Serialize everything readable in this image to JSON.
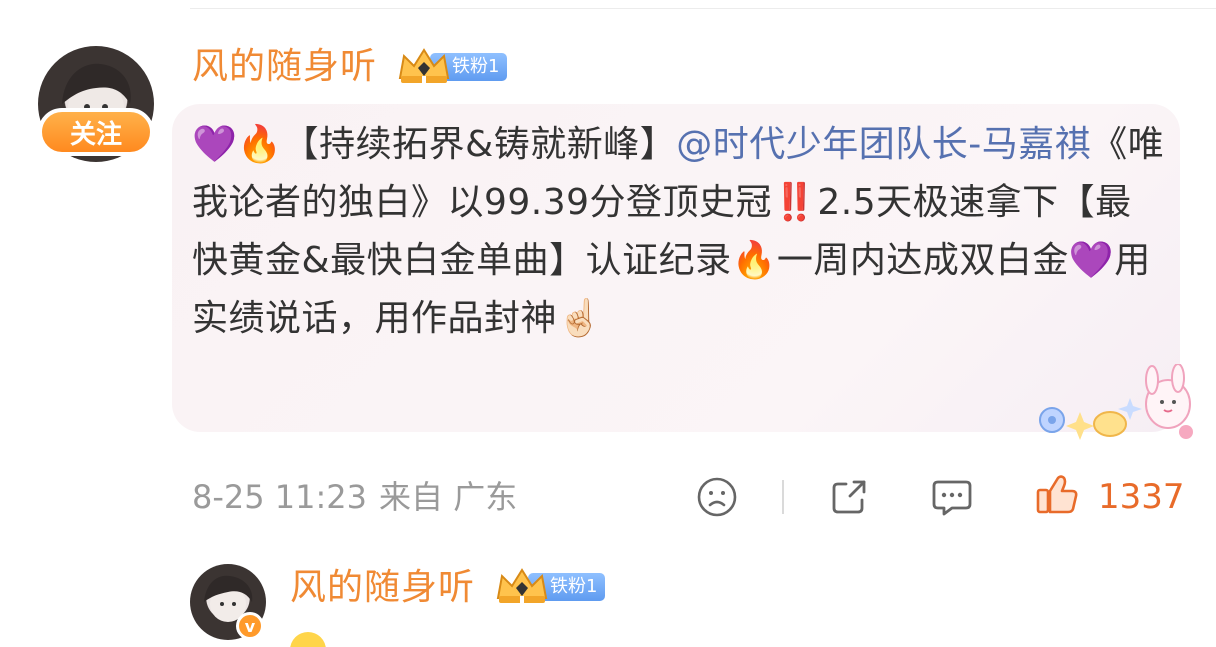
{
  "post": {
    "username": "风的随身听",
    "badge_label": "铁粉1",
    "follow_label": "关注",
    "content": {
      "line1_prefix": "💜🔥【持续拓界&铸就新峰】",
      "mention": "@时代少年团队长-马嘉祺",
      "line_main": "《唯我论者的独白》以99.39分登顶史冠",
      "bang": "‼️",
      "line_rest": "2.5天极速拿下【最快黄金&最快白金单曲】认证纪录",
      "fire2": "🔥",
      "line_tail": "一周内达成双白金",
      "heart2": "💜",
      "line_end": "用实绩说话，用作品封神",
      "point": "☝🏻"
    },
    "timestamp": "8-25 11:23",
    "source": "来自 广东",
    "actions": {
      "dislike_icon": "sad-face-icon",
      "share_icon": "share-icon",
      "comment_icon": "comment-icon",
      "like_icon": "thumbs-up-icon",
      "like_count": "1337"
    }
  },
  "next_post": {
    "username": "风的随身听",
    "badge_label": "铁粉1",
    "verified_mark": "v"
  },
  "colors": {
    "username": "#f08a34",
    "mention": "#5671b0",
    "badge": "#6fa8f5",
    "follow": "#ff9a2f",
    "like": "#e86b2a"
  }
}
